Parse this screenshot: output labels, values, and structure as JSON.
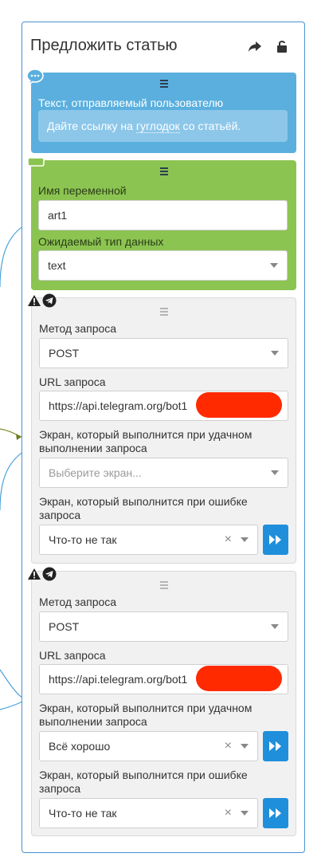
{
  "panel": {
    "title": "Предложить статью"
  },
  "message_block": {
    "label": "Текст, отправляемый пользователю",
    "text_before": "Дайте ссылку на ",
    "text_underlined": "гуглодок",
    "text_after": " со статьёй."
  },
  "variable_block": {
    "name_label": "Имя переменной",
    "name_value": "art1",
    "type_label": "Ожидаемый тип данных",
    "type_value": "text"
  },
  "requests": [
    {
      "method_label": "Метод запроса",
      "method_value": "POST",
      "url_label": "URL запроса",
      "url_value": "https://api.telegram.org/bot1",
      "success_label_line1": "Экран, который выполнится при удачном",
      "success_label_line2": "выполнении запроса",
      "success_placeholder": "Выберите экран...",
      "error_label_line1": "Экран, который выполнится при ошибке",
      "error_label_line2": "запроса",
      "error_value": "Что-то не так",
      "clear_symbol": "×"
    },
    {
      "method_label": "Метод запроса",
      "method_value": "POST",
      "url_label": "URL запроса",
      "url_value": "https://api.telegram.org/bot1",
      "success_label_line1": "Экран, который выполнится при удачном",
      "success_label_line2": "выполнении запроса",
      "success_value": "Всё хорошо",
      "error_label_line1": "Экран, который выполнится при ошибке",
      "error_label_line2": "запроса",
      "error_value": "Что-то не так",
      "clear_symbol": "×"
    }
  ],
  "icons": {
    "header": [
      "share-icon",
      "unlock-icon"
    ],
    "message_block": "chat-bubble-icon",
    "variable_block": "input-field-icon",
    "request_blocks": [
      "warning-icon",
      "telegram-icon",
      "fast-forward-icon"
    ]
  },
  "colors": {
    "panel_border": "#4a8fd0",
    "message_block": "#5aafde",
    "variable_block": "#8cc452",
    "request_block": "#f1f1f1",
    "go_button": "#1f8fdb",
    "redaction": "#ff2a00"
  }
}
